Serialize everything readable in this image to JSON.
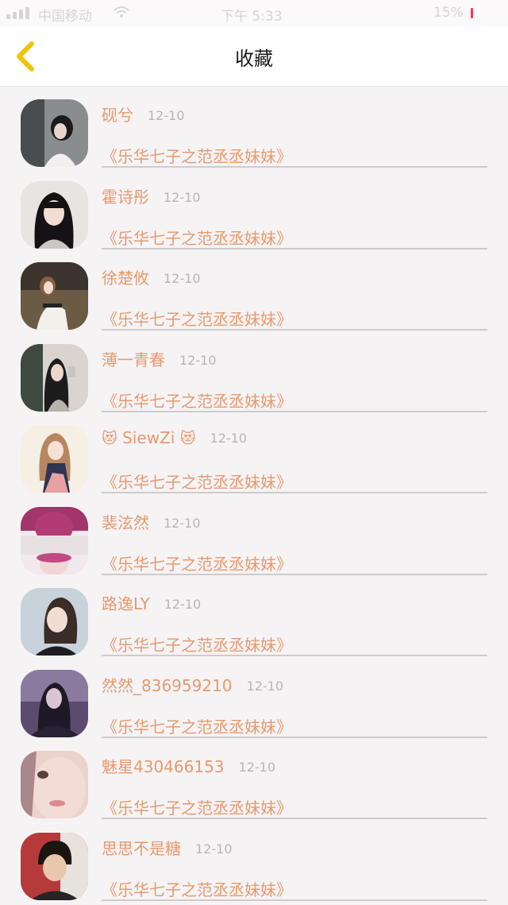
{
  "status_bar": {
    "carrier": "中国移动",
    "time": "下午 5:33",
    "battery": "15%"
  },
  "header": {
    "title": "收藏",
    "back_icon": "chevron-left-icon",
    "accent": "#f2c300"
  },
  "colors": {
    "text_accent": "#e79a6c",
    "date_gray": "#b9b4b6",
    "background": "#f6f3f5"
  },
  "favorites": [
    {
      "name": "砚兮",
      "date": "12-10",
      "title": "《乐华七子之范丞丞妹妹》"
    },
    {
      "name": "霍诗彤",
      "date": "12-10",
      "title": "《乐华七子之范丞丞妹妹》"
    },
    {
      "name": "徐楚攸",
      "date": "12-10",
      "title": "《乐华七子之范丞丞妹妹》"
    },
    {
      "name": "薄一青春",
      "date": "12-10",
      "title": "《乐华七子之范丞丞妹妹》"
    },
    {
      "name_prefix": "😻",
      "name": " SiewZi ",
      "name_suffix": "😻",
      "date": "12-10",
      "title": "《乐华七子之范丞丞妹妹》"
    },
    {
      "name": "裴泫然",
      "date": "12-10",
      "title": "《乐华七子之范丞丞妹妹》"
    },
    {
      "name": "路逸LY",
      "date": "12-10",
      "title": "《乐华七子之范丞丞妹妹》"
    },
    {
      "name": "然然_836959210",
      "date": "12-10",
      "title": "《乐华七子之范丞丞妹妹》"
    },
    {
      "name": "魅星430466153",
      "date": "12-10",
      "title": "《乐华七子之范丞丞妹妹》"
    },
    {
      "name": "思思不是糖",
      "date": "12-10",
      "title": "《乐华七子之范丞丞妹妹》"
    }
  ]
}
